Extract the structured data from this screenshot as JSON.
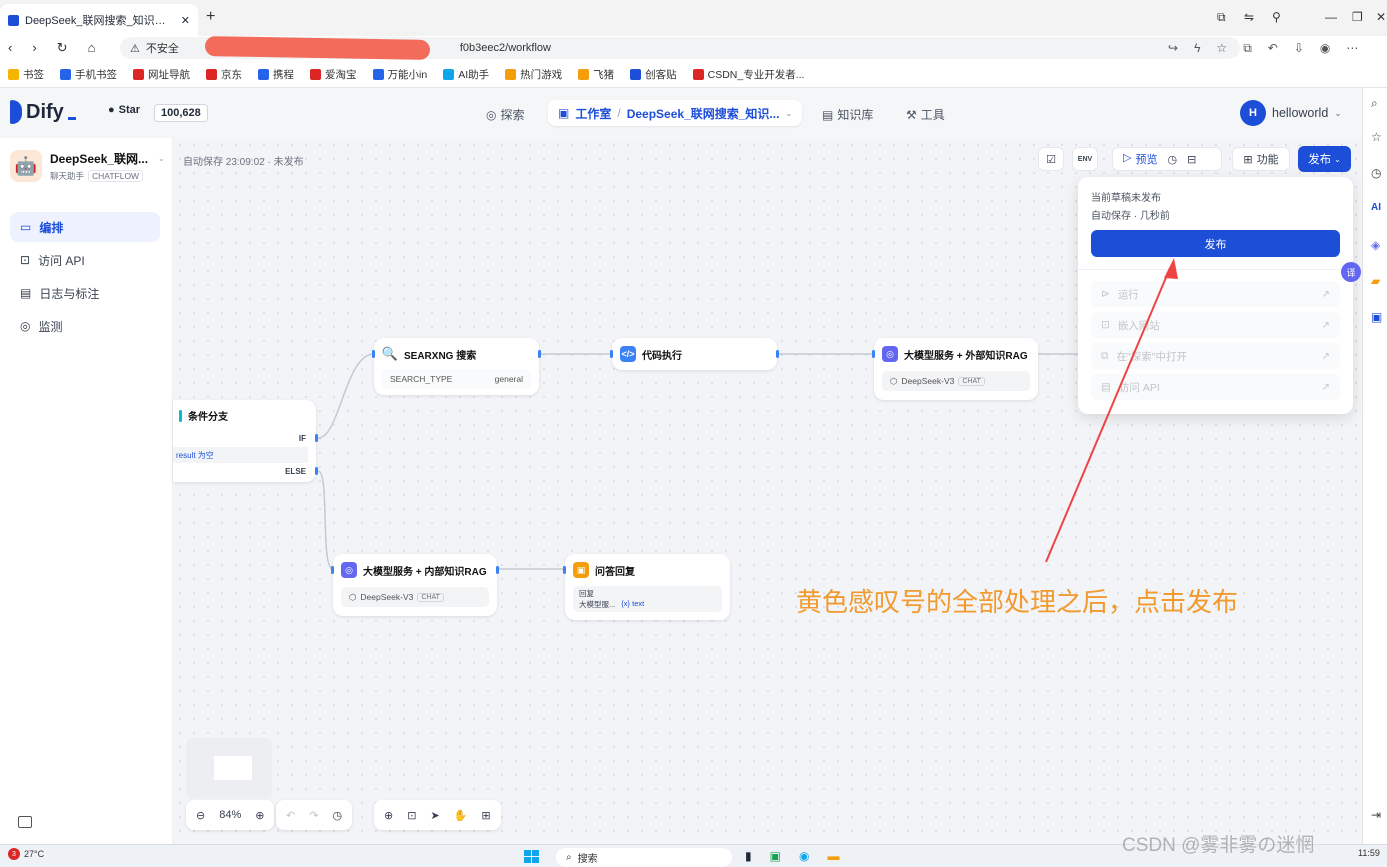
{
  "browser": {
    "tab_title": "DeepSeek_联网搜索_知识库 - Dif",
    "new_tab": "+",
    "url_security": "不安全",
    "url_text": "f0b3eec2/workflow",
    "bookmarks": [
      {
        "label": "书签",
        "color": "#f4b400"
      },
      {
        "label": "手机书签",
        "color": "#2563eb"
      },
      {
        "label": "网址导航",
        "color": "#dc2626"
      },
      {
        "label": "京东",
        "color": "#dc2626"
      },
      {
        "label": "携程",
        "color": "#2563eb"
      },
      {
        "label": "爱淘宝",
        "color": "#dc2626"
      },
      {
        "label": "万能小in",
        "color": "#2563eb"
      },
      {
        "label": "AI助手",
        "color": "#0ea5e9"
      },
      {
        "label": "热门游戏",
        "color": "#f59e0b"
      },
      {
        "label": "飞猪",
        "color": "#f59e0b"
      },
      {
        "label": "创客贴",
        "color": "#1d4ed8"
      },
      {
        "label": "CSDN_专业开发者...",
        "color": "#dc2626"
      }
    ]
  },
  "header": {
    "logo": "Dify",
    "star_label": "Star",
    "star_count": "100,628",
    "nav_explore": "探索",
    "nav_studio": "工作室",
    "nav_separator": "/",
    "nav_app": "DeepSeek_联网搜索_知识...",
    "nav_knowledge": "知识库",
    "nav_tools": "工具",
    "user_initial": "H",
    "user_name": "helloworld"
  },
  "sidebar": {
    "app_name": "DeepSeek_联网...",
    "app_type": "聊天助手",
    "app_mode": "CHATFLOW",
    "items": [
      {
        "label": "编排",
        "icon": "layout-icon",
        "active": true
      },
      {
        "label": "访问 API",
        "icon": "terminal-icon",
        "active": false
      },
      {
        "label": "日志与标注",
        "icon": "log-icon",
        "active": false
      },
      {
        "label": "监测",
        "icon": "monitor-icon",
        "active": false
      }
    ]
  },
  "toolbar": {
    "autosave": "自动保存 23:09:02 · 未发布",
    "env_label": "ENV",
    "preview_label": "预览",
    "features_label": "功能",
    "publish_label": "发布"
  },
  "nodes": {
    "condition": {
      "title": "条件分支",
      "if_label": "IF",
      "else_label": "ELSE",
      "condition_text": "result 为空"
    },
    "searxng": {
      "title": "SEARXNG 搜索",
      "param_name": "SEARCH_TYPE",
      "param_value": "general"
    },
    "code": {
      "title": "代码执行"
    },
    "llm_external": {
      "title": "大模型服务 + 外部知识RAG",
      "model": "DeepSeek-V3",
      "model_tag": "CHAT"
    },
    "llm_internal": {
      "title": "大模型服务 + 内部知识RAG",
      "model": "DeepSeek-V3",
      "model_tag": "CHAT"
    },
    "answer": {
      "title": "问答回复",
      "label": "回复",
      "var_source": "大模型服...",
      "var_name": "{x} text"
    }
  },
  "publish_menu": {
    "status_line": "当前草稿未发布",
    "autosave_line": "自动保存 · 几秒前",
    "publish_button": "发布",
    "items": [
      {
        "label": "运行",
        "icon": "play-icon"
      },
      {
        "label": "嵌入网站",
        "icon": "embed-icon"
      },
      {
        "label": "在\"探索\"中打开",
        "icon": "explore-icon"
      },
      {
        "label": "访问 API",
        "icon": "api-doc-icon"
      }
    ]
  },
  "bottom_tools": {
    "zoom": "84%"
  },
  "annotation": {
    "text": "黄色感叹号的全部处理之后，点击发布",
    "color": "#f29a2e"
  },
  "taskbar": {
    "temperature": "27°C",
    "search_placeholder": "搜索",
    "badge": "3",
    "watermark": "CSDN @雾非雾の迷惘",
    "clock": "11:59"
  }
}
